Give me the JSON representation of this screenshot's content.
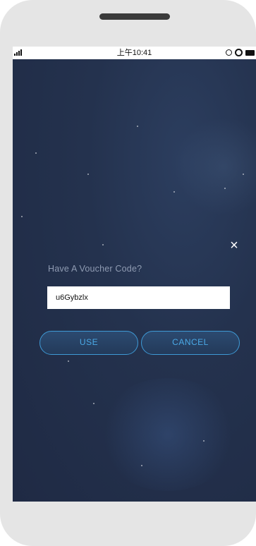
{
  "status_bar": {
    "time": "上午10:41"
  },
  "dialog": {
    "close_label": "×",
    "title": "Have A Voucher Code?",
    "voucher_input": {
      "value": "u6Gybzlx",
      "placeholder": ""
    },
    "use_label": "USE",
    "cancel_label": "CANCEL"
  },
  "colors": {
    "background": "#24324e",
    "button_border": "#3e9ad6",
    "button_text": "#4aa9e6",
    "label_text": "#8f9bb2"
  },
  "icons": [
    "signal-icon",
    "orientation-lock-icon",
    "alarm-icon",
    "battery-icon",
    "close-icon"
  ]
}
